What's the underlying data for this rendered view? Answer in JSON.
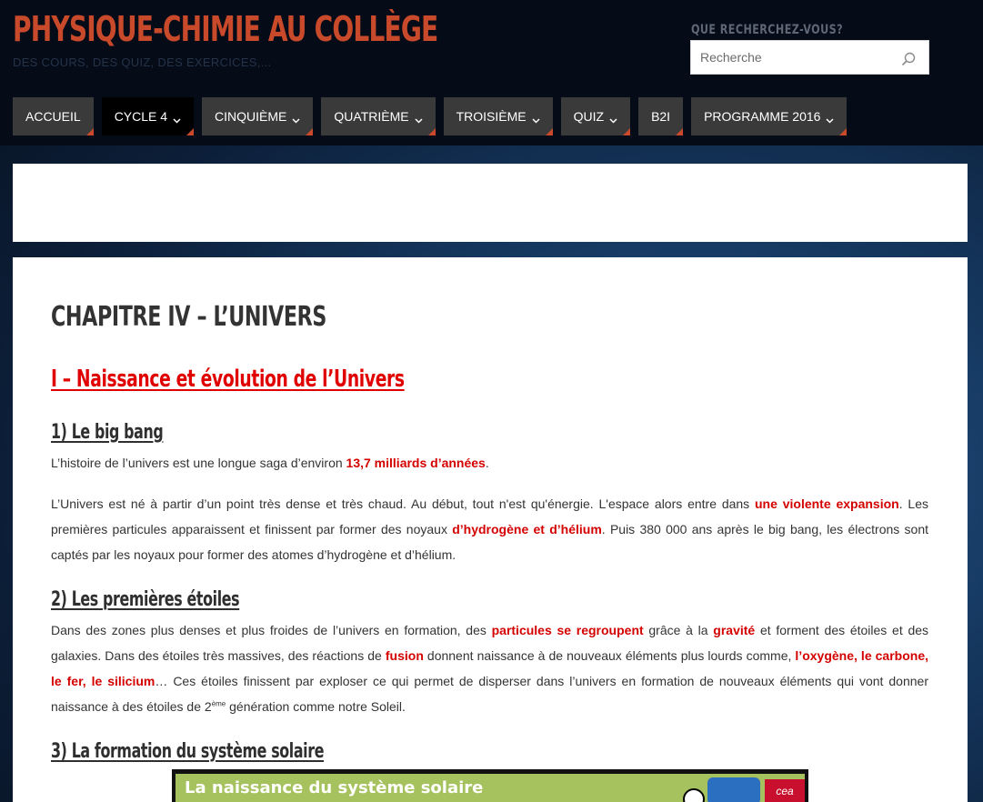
{
  "site": {
    "title": "PHYSIQUE-CHIMIE AU COLLÈGE",
    "tagline": "DES COURS, DES QUIZ, DES EXERCICES,..."
  },
  "search": {
    "label": "QUE RECHERCHEZ-VOUS?",
    "placeholder": "Recherche"
  },
  "nav": [
    {
      "label": "ACCUEIL",
      "dropdown": false,
      "active": false
    },
    {
      "label": "CYCLE 4",
      "dropdown": true,
      "active": true
    },
    {
      "label": "CINQUIÈME",
      "dropdown": true,
      "active": false
    },
    {
      "label": "QUATRIÈME",
      "dropdown": true,
      "active": false
    },
    {
      "label": "TROISIÈME",
      "dropdown": true,
      "active": false
    },
    {
      "label": "QUIZ",
      "dropdown": true,
      "active": false
    },
    {
      "label": "B2I",
      "dropdown": false,
      "active": false
    },
    {
      "label": "PROGRAMME 2016",
      "dropdown": true,
      "active": false
    }
  ],
  "article": {
    "title": "CHAPITRE IV – L’UNIVERS",
    "section1": "I – Naissance et évolution de l’Univers",
    "sub1": "1) Le big bang",
    "p1": {
      "a": " L’histoire de l’univers est une longue saga d’environ ",
      "b": "13,7 milliards d’années",
      "c": "."
    },
    "p2": {
      "a": " L’Univers est né à partir d’un point très dense et très chaud. Au début, tout n'est qu'énergie. L'espace alors entre dans ",
      "b": "une violente expansion",
      "c": ". Les premières particules apparaissent et finissent par former des noyaux ",
      "d": "d’hydrogène et d’hélium",
      "e": ". Puis 380 000 ans après le big bang, les électrons sont captés par les noyaux pour former des atomes d’hydrogène et d’hélium."
    },
    "sub2": "2) Les premières étoiles",
    "p3": {
      "a": " Dans des zones plus denses et plus froides de l’univers en formation, des ",
      "b": "particules se regroupent",
      "c": " grâce à la ",
      "d": "gravité",
      "e": " et forment des étoiles et des galaxies. Dans des étoiles très massives, des réactions de ",
      "f": "fusion",
      "g": " donnent naissance à de nouveaux éléments plus lourds comme, ",
      "h": "l’oxygène, le carbone, le fer, le silicium",
      "i": "… Ces étoiles finissent par exploser ce qui permet de disperser dans l’univers en formation de nouveaux éléments qui vont donner naissance à des étoiles de 2",
      "sup": "ème",
      "j": " génération comme notre Soleil."
    },
    "sub3": "3) La formation du système solaire",
    "video_title": "La naissance du système solaire",
    "video_logo2": "cea"
  },
  "colors": {
    "accent": "#c94a2a",
    "highlight": "#d40000",
    "nav_bg": "#3a3a3a"
  }
}
